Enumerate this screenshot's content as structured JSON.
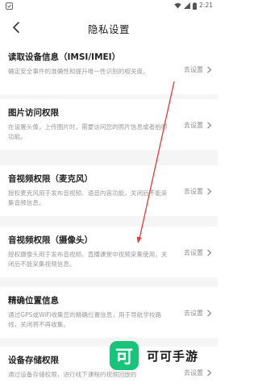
{
  "status_bar": {
    "time": "2:21"
  },
  "header": {
    "title": "隐私设置"
  },
  "items": [
    {
      "title": "读取设备信息（IMSI/IMEI）",
      "description": "确定安全事件的准确性和提升唯一性识别的相关度。",
      "action": "去设置"
    },
    {
      "title": "图片访问权限",
      "description": "在设置头像，上传图片时，需要访问您的照片信息或者拍照功能。",
      "action": "去设置"
    },
    {
      "title": "音视频权限（麦克风）",
      "description": "授权麦克风用于发布音视频、语音内容功能，关闭后不能采集音频信息。",
      "action": "去设置"
    },
    {
      "title": "音视频权限（摄像头）",
      "description": "授权摄像头用于发布音视频、直播课堂中视频采集使用，关闭后不能采集视频信息。",
      "action": "去设置"
    },
    {
      "title": "精确位置信息",
      "description": "通过GPS或WiFi收集您的精确位置信息，用于导航学校路线，关闭将不再收集。",
      "action": "去设置"
    },
    {
      "title": "设备存储权限",
      "description": "通过设备存储权限，进行线下课程的视频回放的",
      "action": "去设置"
    }
  ],
  "watermark": {
    "logo_char": "可",
    "brand": "可可手游"
  },
  "colors": {
    "annotation_arrow": "#e53935",
    "brand_green": "#17c47a"
  }
}
